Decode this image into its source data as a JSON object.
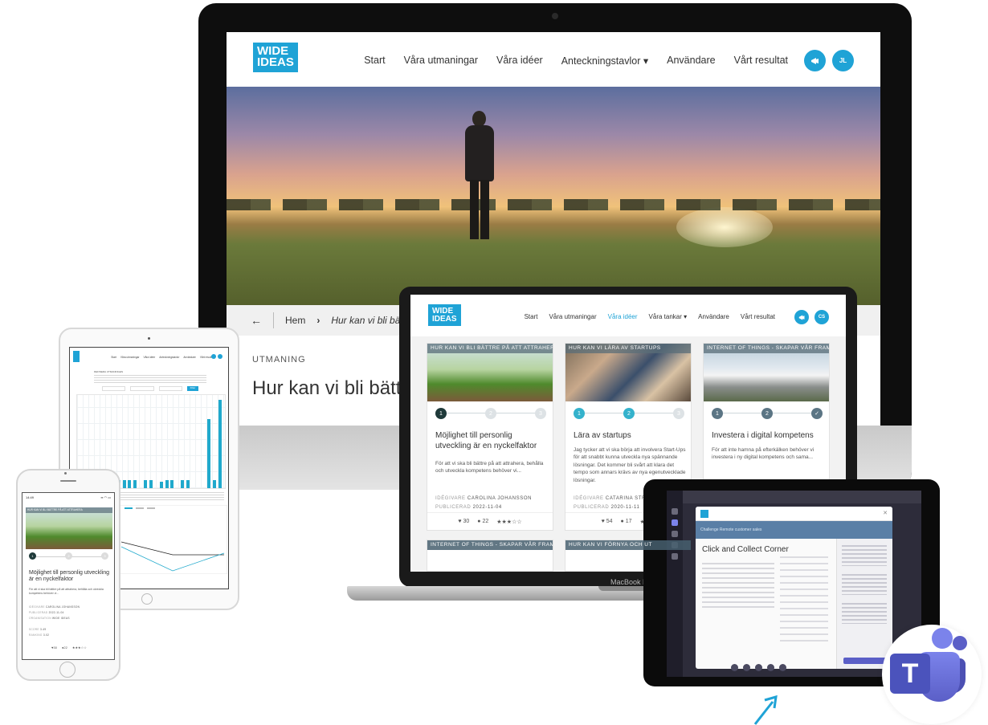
{
  "desktop": {
    "logo": [
      "WIDE",
      "IDEAS"
    ],
    "nav": [
      "Start",
      "Våra utmaningar",
      "Våra idéer",
      "Anteckningstavlor",
      "Användare",
      "Vårt resultat"
    ],
    "nav_dropdown_icon": "chevron-down-icon",
    "bell_icon": "megaphone-icon",
    "avatar_initials": "JL",
    "breadcrumb": {
      "home": "Hem",
      "current": "Hur kan vi bli bättre på att a"
    },
    "eyebrow": "UTMANING",
    "headline": "Hur kan vi bli bättre"
  },
  "laptop": {
    "logo": [
      "WIDE",
      "IDEAS"
    ],
    "nav": [
      "Start",
      "Våra utmaningar",
      "Våra idéer",
      "Våra tankar",
      "Användare",
      "Vårt resultat"
    ],
    "active_nav": "Våra idéer",
    "avatar_initials": "CS",
    "device_label": "MacBook Pr",
    "cards": [
      {
        "tag": "HUR KAN VI BLI BÄTTRE PÅ ATT ATTRAHERA",
        "title": "Möjlighet till personlig utveckling är en nyckelfaktor",
        "text": "För att vi ska bli bättre på att attrahera, behålla och utveckla kompetens behöver vi...",
        "owner_label": "IDÉGIVARE",
        "owner": "CAROLINA JOHANSSON",
        "published_label": "PUBLICERAD",
        "published": "2022-11-04",
        "likes": "30",
        "comments": "22",
        "rating": "★★★☆☆",
        "progress": 1,
        "steps": [
          "1",
          "2",
          "3"
        ]
      },
      {
        "tag": "HUR KAN VI LÄRA AV STARTUPS",
        "title": "Lära av startups",
        "text": "Jag tycker att vi ska börja att involvera Start-Ups för att snabbt kunna utveckla nya spännande lösningar. Det kommer bli svårt att klara det tempo som annars krävs av nya egenutvecklade lösningar.",
        "owner_label": "IDÉGIVARE",
        "owner": "CATARINA STRÖM",
        "published_label": "PUBLICERAD",
        "published": "2020-11-11",
        "likes": "54",
        "comments": "17",
        "rating": "★★★",
        "progress": 2,
        "steps": [
          "1",
          "2",
          "3"
        ]
      },
      {
        "tag": "INTERNET OF THINGS - SKAPAR VÅR FRAMTID",
        "title": "Investera i digital kompetens",
        "text": "För att inte hamna på efterkälken behöver vi investera i ny digital kompetens och sama...",
        "progress": 3,
        "steps": [
          "1",
          "2",
          "✓"
        ]
      }
    ],
    "bottom_cards": [
      {
        "tag": "INTERNET OF THINGS - SKAPAR VÅR FRAMTID"
      },
      {
        "tag": "HUR KAN VI FÖRNYA OCH UT"
      }
    ]
  },
  "ipad": {
    "nav": [
      "Start",
      "Våra utmaningar",
      "Våra idéer",
      "Anteckningstavlor",
      "Användare",
      "Vårt resultat"
    ],
    "section_label": "DEFINERA UTMANINGEN",
    "filter_label": "Filter",
    "bars": [
      0,
      0,
      0,
      0,
      0,
      0,
      0,
      0,
      0,
      0,
      0,
      0,
      0,
      0,
      0,
      0,
      0,
      0,
      0,
      0,
      0,
      0,
      0,
      0,
      0,
      0
    ]
  },
  "iphone": {
    "time": "14:49",
    "tag": "HUR KAN VI BLI BÄTTRE PÅ ATT ATTRAHERA",
    "title": "Möjlighet till personlig utveckling är en nyckelfaktor",
    "text": "För att vi ska bli bättre på att attrahera, behålla och utveckla kompetens behöver vi...",
    "owner_label": "IDÉGIVARE",
    "owner": "CAROLINA JOHANSSON",
    "published_label": "PUBLICERAD",
    "published": "2022-11-04",
    "org_label": "ORGANISATION",
    "org": "WIDE IDEAS",
    "score_label": "SCORE",
    "score": "3.49",
    "ranking_label": "RANKING",
    "ranking": "3.02",
    "likes": "30",
    "comments": "22",
    "rating": "★★★☆☆",
    "steps": [
      "1",
      "2",
      "3"
    ]
  },
  "teams": {
    "band_text": "Challenge  Remote customer sales",
    "modal_title": "Click and Collect Corner",
    "brand_color": "#5b5fc7",
    "letter": "T"
  },
  "colors": {
    "accent": "#1fa3d6",
    "dark_step": "#1f3a3a",
    "cyan_step": "#34b2cc"
  }
}
